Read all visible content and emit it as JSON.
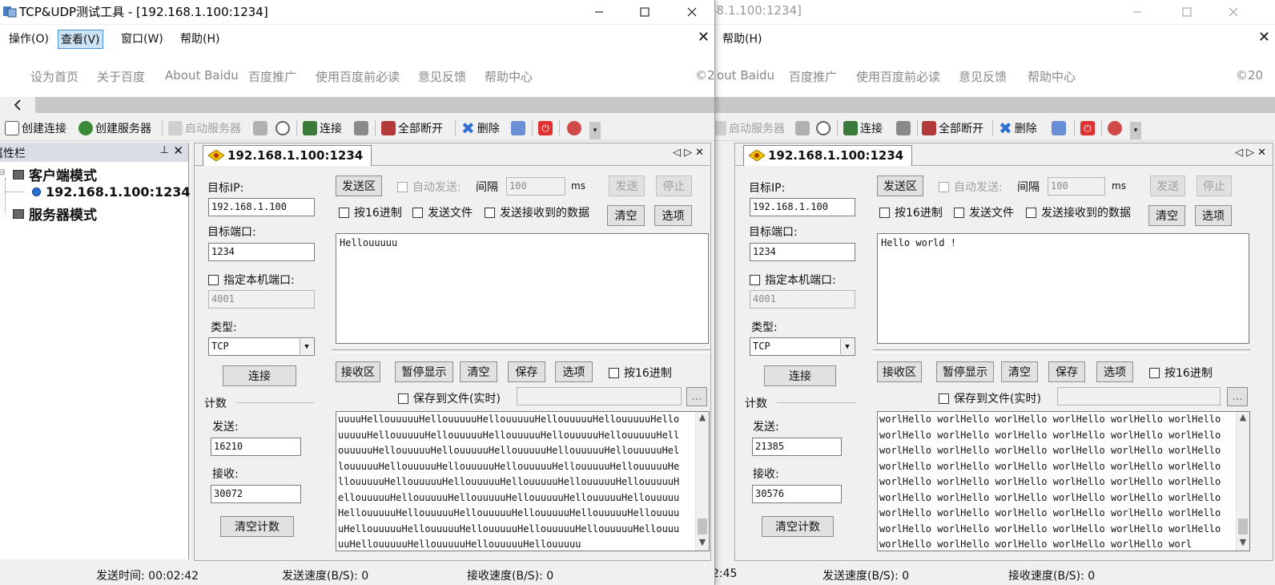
{
  "window1": {
    "title": "TCP&UDP测试工具 - [192.168.1.100:1234]",
    "menu": [
      "操作(O)",
      "查看(V)",
      "窗口(W)",
      "帮助(H)"
    ],
    "menu_active": "查看(V)",
    "baidu_links": [
      "设为首页",
      "关于百度",
      "About Baidu",
      "百度推广",
      "使用百度前必读",
      "意见反馈",
      "帮助中心"
    ],
    "baidu_right": "©20",
    "toolbar": {
      "create_conn": "创建连接",
      "create_server": "创建服务器",
      "start_server": "启动服务器",
      "connect": "连接",
      "disconnect_all": "全部断开",
      "delete": "删除"
    },
    "sidebar": {
      "title": "属性栏",
      "client_mode": "客户端模式",
      "client_item": "192.168.1.100:1234",
      "server_mode": "服务器模式"
    },
    "tab_label": "192.168.1.100:1234",
    "form": {
      "target_ip_label": "目标IP:",
      "target_ip": "192.168.1.100",
      "target_port_label": "目标端口:",
      "target_port": "1234",
      "local_port_label": "指定本机端口:",
      "local_port": "4001",
      "type_label": "类型:",
      "type_value": "TCP",
      "connect_button": "连接",
      "count_label": "计数",
      "send_label": "发送:",
      "send_count": "16210",
      "recv_label": "接收:",
      "recv_count": "30072",
      "clear_count_button": "清空计数"
    },
    "send": {
      "area_button": "发送区",
      "auto_send": "自动发送:",
      "interval_label": "间隔",
      "interval_value": "100",
      "ms": "ms",
      "send_button": "发送",
      "stop_button": "停止",
      "hex": "按16进制",
      "send_file": "发送文件",
      "send_received": "发送接收到的数据",
      "clear_button": "清空",
      "options_button": "选项",
      "text": "Hellouuuuu"
    },
    "recv": {
      "area_button": "接收区",
      "pause_button": "暂停显示",
      "clear_button": "清空",
      "save_button": "保存",
      "options_button": "选项",
      "hex": "按16进制",
      "save_to_file": "保存到文件(实时)",
      "browse": "...",
      "lines": [
        "uuuuHellouuuuuHellouuuuuHellouuuuuHellouuuuuHellouuuuuHello",
        "uuuuuHellouuuuuHellouuuuuHellouuuuuHellouuuuuHellouuuuuHell",
        "ouuuuuHellouuuuuHellouuuuuHellouuuuuHellouuuuuHellouuuuuHel",
        "louuuuuHellouuuuuHellouuuuuHellouuuuuHellouuuuuHellouuuuuHe",
        "llouuuuuHellouuuuuHellouuuuuHellouuuuuHellouuuuuHellouuuuuH",
        "ellouuuuuHellouuuuuHellouuuuuHellouuuuuHellouuuuuHellouuuuu",
        "HellouuuuuHellouuuuuHellouuuuuHellouuuuuHellouuuuuHellouuuu",
        "uHellouuuuuHellouuuuuHellouuuuuHellouuuuuHellouuuuuHellouuu",
        "uuHellouuuuuHellouuuuuHellouuuuuHellouuuuu"
      ]
    },
    "status": {
      "send_time": "发送时间: 00:02:42",
      "send_speed": "发送速度(B/S): 0",
      "recv_speed": "接收速度(B/S): 0"
    }
  },
  "window2": {
    "title": "68.1.100:1234]",
    "menu": [
      "帮助(H)"
    ],
    "baidu_links": [
      "out Baidu",
      "百度推广",
      "使用百度前必读",
      "意见反馈",
      "帮助中心"
    ],
    "baidu_left": "©2",
    "baidu_right": "©20",
    "toolbar": {
      "start_server": "启动服务器",
      "connect": "连接",
      "disconnect_all": "全部断开",
      "delete": "删除"
    },
    "tab_label": "192.168.1.100:1234",
    "form": {
      "target_ip_label": "目标IP:",
      "target_ip": "192.168.1.100",
      "target_port_label": "目标端口:",
      "target_port": "1234",
      "local_port_label": "指定本机端口:",
      "local_port": "4001",
      "type_label": "类型:",
      "type_value": "TCP",
      "connect_button": "连接",
      "count_label": "计数",
      "send_label": "发送:",
      "send_count": "21385",
      "recv_label": "接收:",
      "recv_count": "30576",
      "clear_count_button": "清空计数"
    },
    "send": {
      "area_button": "发送区",
      "auto_send": "自动发送:",
      "interval_label": "间隔",
      "interval_value": "100",
      "ms": "ms",
      "send_button": "发送",
      "stop_button": "停止",
      "hex": "按16进制",
      "send_file": "发送文件",
      "send_received": "发送接收到的数据",
      "clear_button": "清空",
      "options_button": "选项",
      "text": "Hello world !"
    },
    "recv": {
      "area_button": "接收区",
      "pause_button": "暂停显示",
      "clear_button": "清空",
      "save_button": "保存",
      "options_button": "选项",
      "hex": "按16进制",
      "save_to_file": "保存到文件(实时)",
      "browse": "...",
      "lines": [
        "worlHello worlHello worlHello worlHello worlHello worlHello",
        "worlHello worlHello worlHello worlHello worlHello worlHello",
        "worlHello worlHello worlHello worlHello worlHello worlHello",
        "worlHello worlHello worlHello worlHello worlHello worlHello",
        "worlHello worlHello worlHello worlHello worlHello worlHello",
        "worlHello worlHello worlHello worlHello worlHello worlHello",
        "worlHello worlHello worlHello worlHello worlHello worlHello",
        "worlHello worlHello worlHello worlHello worlHello worlHello",
        "worlHello worlHello worlHello worlHello worlHello worl"
      ]
    },
    "status": {
      "send_time": "2:45",
      "send_speed": "发送速度(B/S): 0",
      "recv_speed": "接收速度(B/S): 0"
    }
  },
  "colors": {
    "accent": "#4a90d6",
    "toolbar_bg": "#f0f0f0",
    "sidebar_head": "#dadde6",
    "tree_bullet": "#2f6fd1"
  }
}
